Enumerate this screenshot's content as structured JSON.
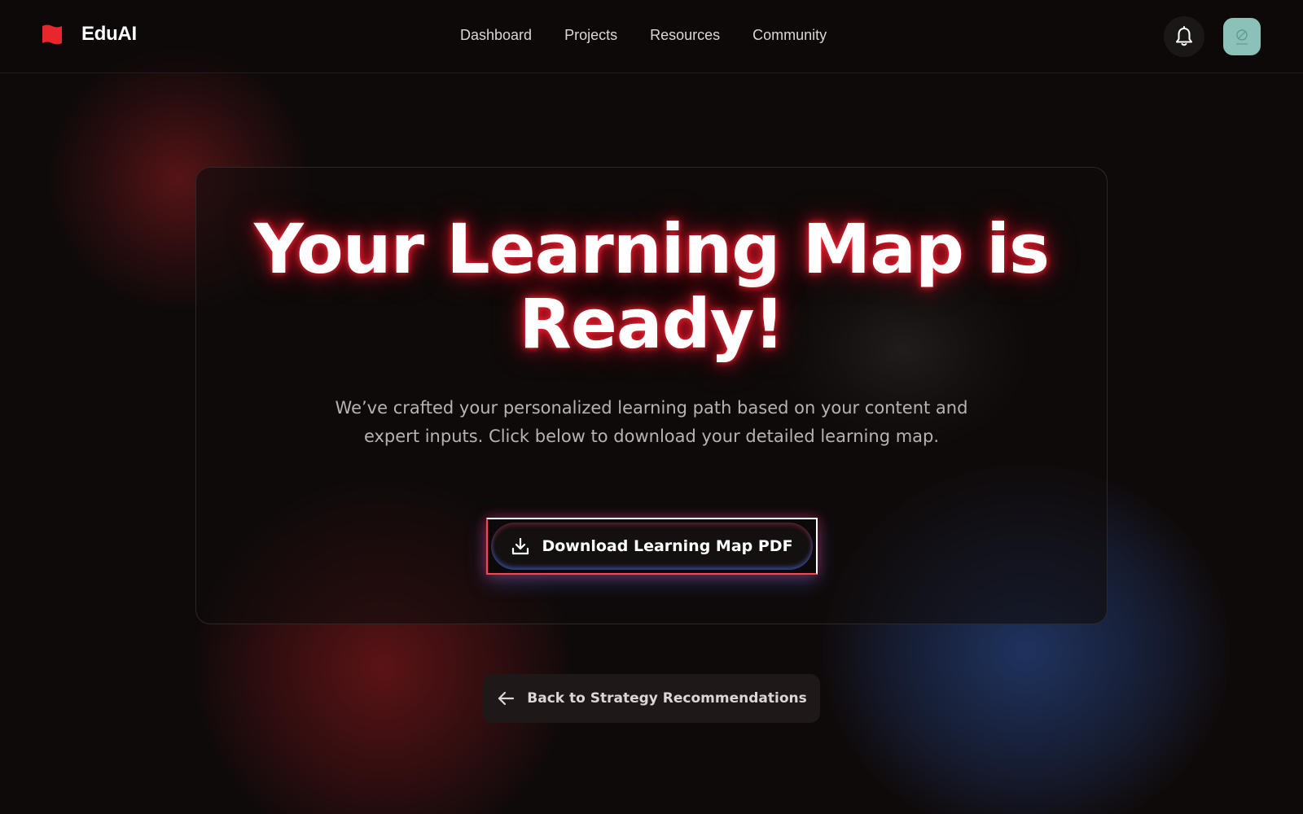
{
  "brand": {
    "name": "EduAI",
    "accent": "#e8272d"
  },
  "nav": {
    "items": [
      {
        "label": "Dashboard"
      },
      {
        "label": "Projects"
      },
      {
        "label": "Resources"
      },
      {
        "label": "Community"
      }
    ]
  },
  "header_actions": {
    "notification_icon": "bell-icon",
    "avatar_icon": "avatar-image"
  },
  "hero": {
    "title_line1": "Your Learning Map is",
    "title_line2": "Ready!",
    "subtitle_line1": "We’ve crafted your personalized learning path based on your content and",
    "subtitle_line2": "expert inputs. Click below to download your detailed learning map."
  },
  "download_button": {
    "label": "Download Learning Map PDF",
    "icon": "download-icon"
  },
  "back_button": {
    "label": "Back to Strategy Recommendations",
    "icon": "arrow-left-icon"
  },
  "colors": {
    "background": "#0f0a0a",
    "glow_red": "#ff2837",
    "glow_blue": "#223a6e",
    "avatar_bg": "#8cc1b8"
  }
}
